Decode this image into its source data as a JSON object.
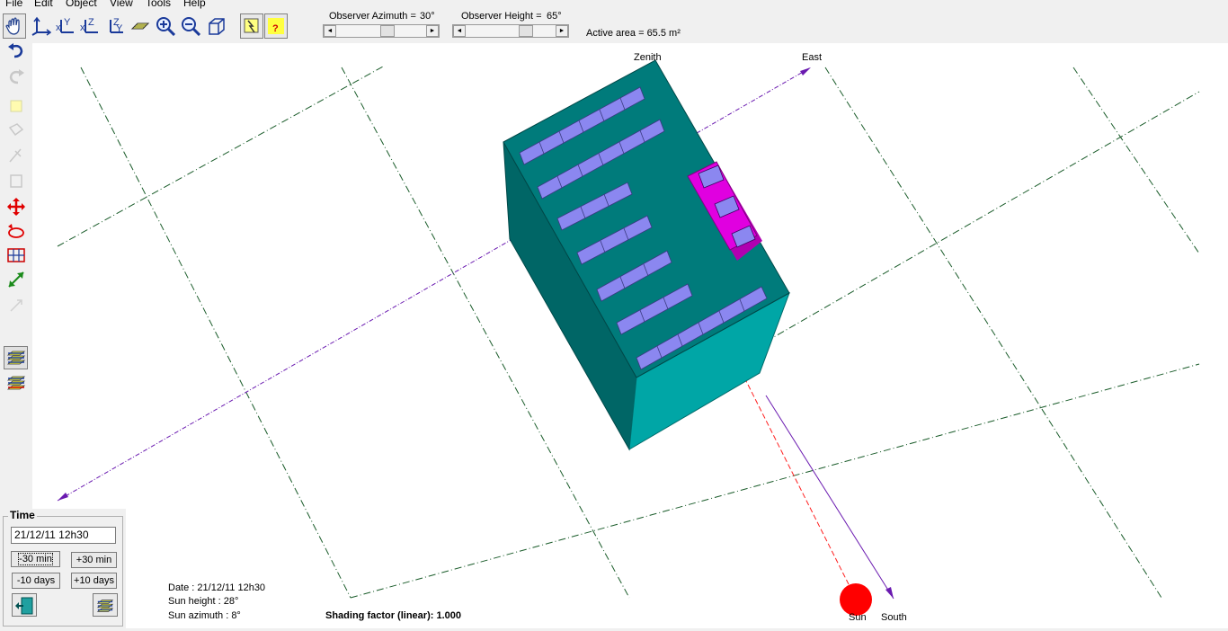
{
  "menu": [
    "File",
    "Edit",
    "Object",
    "View",
    "Tools",
    "Help"
  ],
  "toolbar": {
    "observer_azimuth_label": "Observer Azimuth =",
    "observer_azimuth_value": "30°",
    "observer_height_label": "Observer Height =",
    "observer_height_value": "65°",
    "active_area": "Active area = 65.5 m²",
    "buttons": [
      "hand-pan-icon",
      "axes-3d-icon",
      "view-xy-icon",
      "view-xz-icon",
      "view-zy-icon",
      "top-view-icon",
      "zoom-in-icon",
      "zoom-out-icon",
      "box-view-icon",
      "flash-card-icon",
      "help-icon"
    ]
  },
  "sidebar": {
    "buttons": [
      "undo-icon",
      "redo-icon",
      "new-object-icon",
      "edit-object-icon",
      "draw-icon",
      "copy-icon",
      "move-icon",
      "rotate-icon",
      "grid-icon",
      "resize-icon",
      "point-icon",
      "layers-icon",
      "layers-multi-icon"
    ]
  },
  "scene": {
    "labels": {
      "zenith": "Zenith",
      "east": "East",
      "south": "South",
      "sun": "Sun"
    },
    "colors": {
      "building_top": "#007b7b",
      "building_right": "#00a6a6",
      "building_left": "#006666",
      "panels": "#8b87f0",
      "magenta": "#e000e0",
      "sun": "#ff0000",
      "axis": "#6a1ab0",
      "grid": "#1a5c2a"
    }
  },
  "time_panel": {
    "legend": "Time",
    "value": "21/12/11 12h30",
    "minus30": "-30 min",
    "plus30": "+30 min",
    "minus10days": "-10 days",
    "plus10days": "+10  days"
  },
  "info": {
    "date": "Date :  21/12/11 12h30",
    "sun_height": "Sun height : 28°",
    "sun_azimuth": "Sun azimuth : 8°",
    "shading_label": "Shading factor (linear):",
    "shading_value": "1.000"
  }
}
